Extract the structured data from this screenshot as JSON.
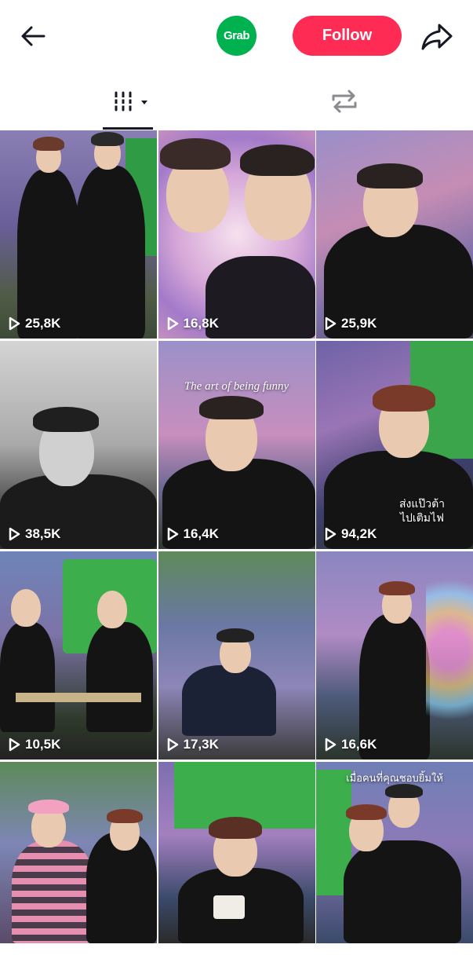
{
  "header": {
    "back_icon": "arrow-left-icon",
    "avatar_text": "Grab",
    "follow_label": "Follow",
    "share_icon": "share-arrow-icon"
  },
  "tabs": [
    {
      "name": "videos",
      "icon": "grid-bars-icon",
      "selected": true
    },
    {
      "name": "reposts",
      "icon": "repost-icon",
      "selected": false
    }
  ],
  "videos": [
    {
      "views": "25,8K"
    },
    {
      "views": "16,8K"
    },
    {
      "views": "25,9K"
    },
    {
      "views": "38,5K"
    },
    {
      "views": "16,4K",
      "caption": "The art of being funny"
    },
    {
      "views": "94,2K",
      "caption": "ส่งแป๊วต้า\nไปเติมไฟ"
    },
    {
      "views": "10,5K"
    },
    {
      "views": "17,3K"
    },
    {
      "views": "16,6K"
    },
    {
      "views": ""
    },
    {
      "views": ""
    },
    {
      "views": "",
      "caption": "เมื่อคนที่คุณชอบยิ้มให้"
    }
  ]
}
